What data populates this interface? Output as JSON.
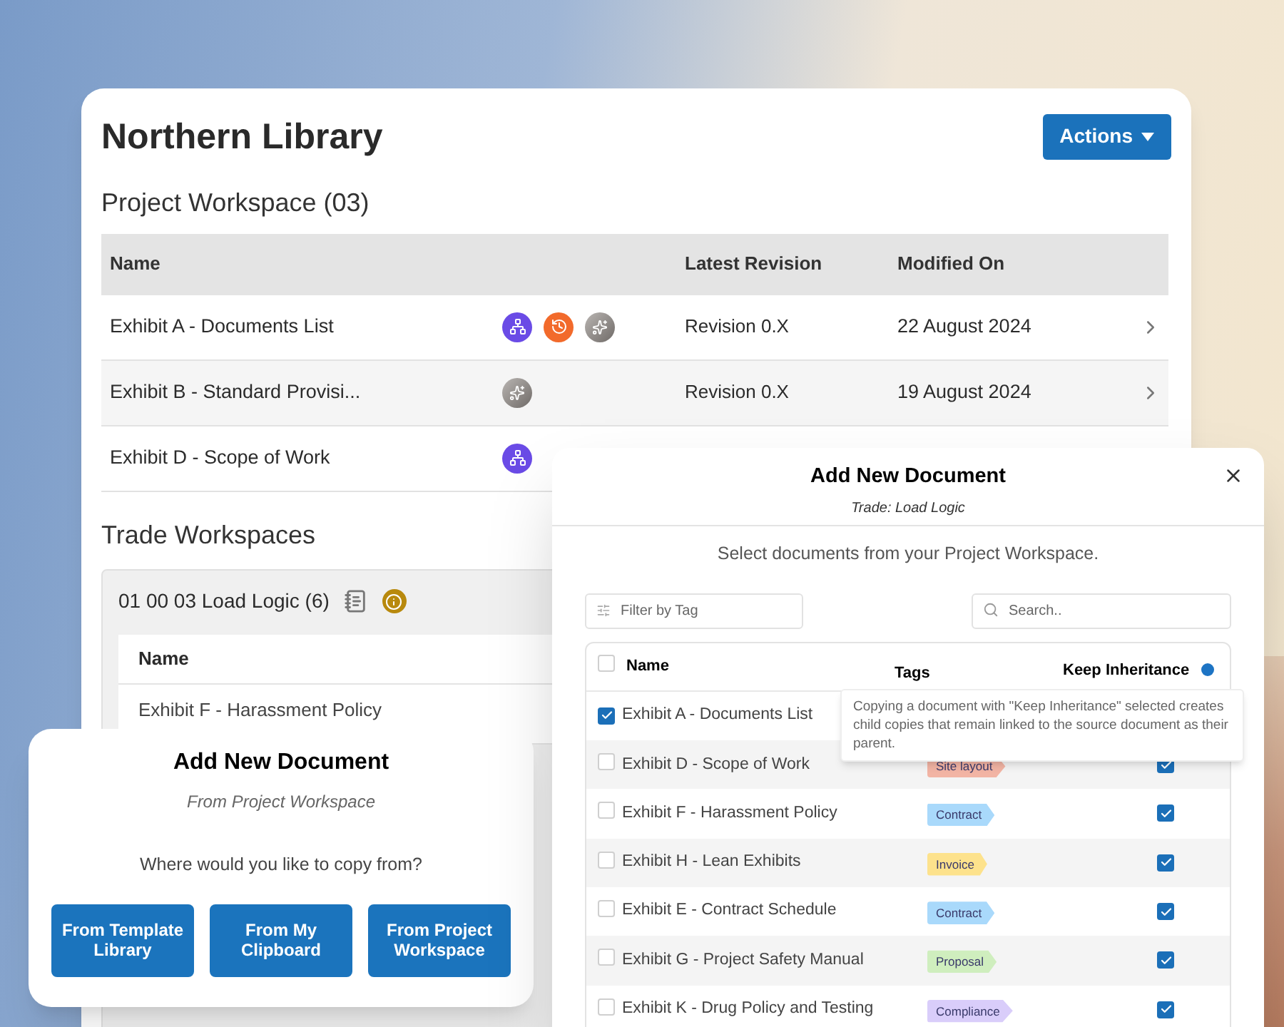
{
  "page": {
    "title": "Northern Library",
    "actions_button": "Actions"
  },
  "project_workspace": {
    "heading": "Project Workspace (03)",
    "columns": [
      "Name",
      "Latest Revision",
      "Modified On"
    ],
    "rows": [
      {
        "name": "Exhibit A - Documents List",
        "icons": [
          {
            "kind": "hierarchy"
          },
          {
            "kind": "history"
          },
          {
            "kind": "ai"
          }
        ],
        "revision": "Revision 0.X",
        "modified": "22 August 2024"
      },
      {
        "name": "Exhibit B - Standard Provisi...",
        "icons": [
          {
            "kind": "ai"
          }
        ],
        "revision": "Revision 0.X",
        "modified": "19 August 2024"
      },
      {
        "name": "Exhibit D - Scope of Work",
        "icons": [
          {
            "kind": "hierarchy"
          }
        ]
      }
    ]
  },
  "trade_workspaces": {
    "heading": "Trade Workspaces",
    "group_title": "01 00 03 Load Logic (6)",
    "columns": [
      "Name"
    ],
    "rows": [
      "Exhibit F - Harassment Policy"
    ]
  },
  "copy_dialog": {
    "title": "Add New Document",
    "subtitle": "From Project Workspace",
    "question": "Where would you like to copy from?",
    "buttons": [
      "From Template Library",
      "From My Clipboard",
      "From Project Workspace"
    ]
  },
  "select_dialog": {
    "title": "Add New Document",
    "subtitle": "Trade: Load Logic",
    "instruction": "Select documents from your Project Workspace.",
    "filter": {
      "placeholder": "Filter by Tag"
    },
    "search": {
      "placeholder": "Search.."
    },
    "columns": [
      "Name",
      "Tags",
      "Keep Inheritance"
    ],
    "all_selected": false,
    "tooltip": "Copying a document with \"Keep Inheritance\" selected creates child copies that remain linked to the source document as their parent.",
    "rows": [
      {
        "name": "Exhibit A - Documents List",
        "selected": true
      },
      {
        "name": "Exhibit D - Scope of Work",
        "selected": false,
        "tag": {
          "label": "Site layout",
          "color": "#f2b4a4"
        },
        "keep_inheritance": true
      },
      {
        "name": "Exhibit F - Harassment Policy",
        "selected": false,
        "tag": {
          "label": "Contract",
          "color": "#a9d9fb"
        },
        "keep_inheritance": true
      },
      {
        "name": "Exhibit H - Lean Exhibits",
        "selected": false,
        "tag": {
          "label": "Invoice",
          "color": "#fde28c"
        },
        "keep_inheritance": true
      },
      {
        "name": "Exhibit E - Contract Schedule",
        "selected": false,
        "tag": {
          "label": "Contract",
          "color": "#a9d9fb"
        },
        "keep_inheritance": true
      },
      {
        "name": "Exhibit G - Project Safety Manual",
        "selected": false,
        "tag": {
          "label": "Proposal",
          "color": "#cfeebe"
        },
        "keep_inheritance": true
      },
      {
        "name": "Exhibit K - Drug Policy and Testing",
        "selected": false,
        "tag": {
          "label": "Compliance",
          "color": "#d9cdfa"
        },
        "keep_inheritance": true
      }
    ]
  }
}
